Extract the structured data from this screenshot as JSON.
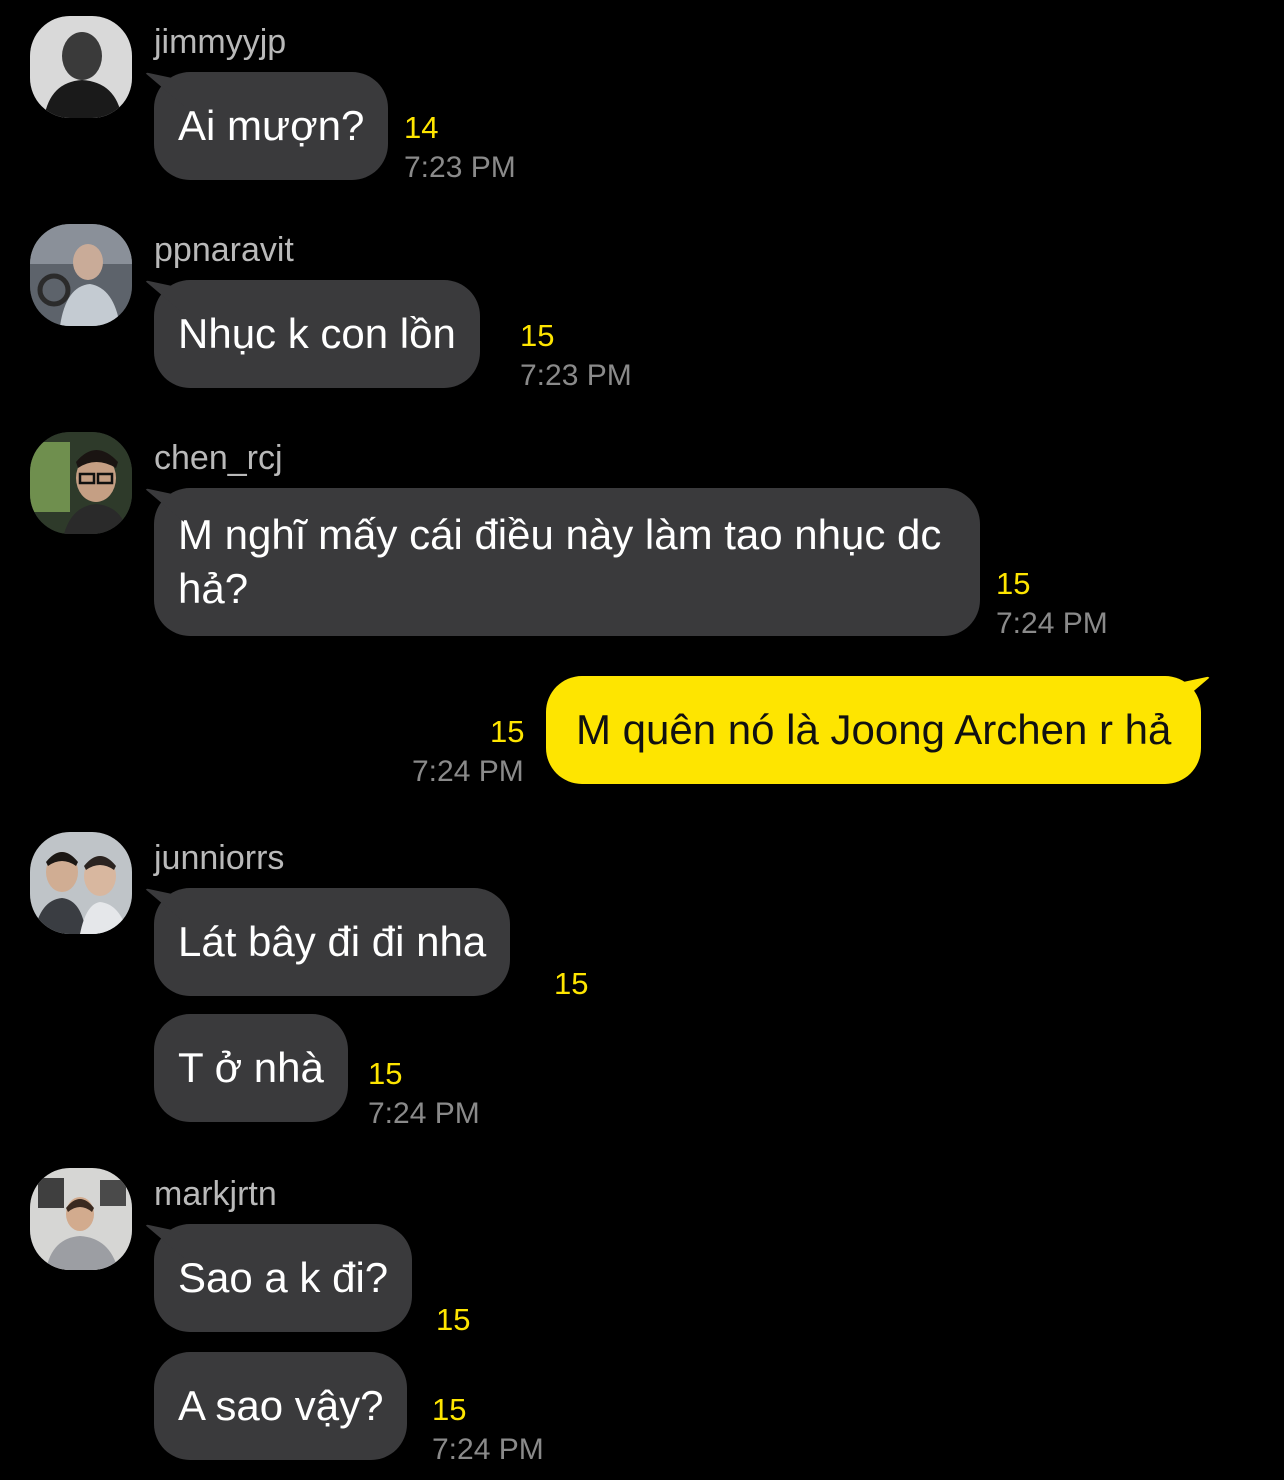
{
  "colors": {
    "background": "#000000",
    "incoming_bubble": "#3a3a3c",
    "outgoing_bubble": "#fee500",
    "unread_count": "#fee500",
    "timestamp": "#8a8a8a",
    "sender_name": "#b9b9b9"
  },
  "messages": [
    {
      "sender": "jimmyyjp",
      "avatar": "avatar-photo-icon",
      "text": "Ai mượn?",
      "unread": "14",
      "time": "7:23 PM"
    },
    {
      "sender": "ppnaravit",
      "avatar": "avatar-photo-icon",
      "text": "Nhục k con lồn",
      "unread": "15",
      "time": "7:23 PM"
    },
    {
      "sender": "chen_rcj",
      "avatar": "avatar-photo-icon",
      "text": "M nghĩ mấy cái điều này làm tao nhục dc hả?",
      "unread": "15",
      "time": "7:24 PM"
    },
    {
      "sender": "",
      "outgoing": true,
      "text": "M quên nó là Joong Archen r hả",
      "unread": "15",
      "time": "7:24 PM"
    },
    {
      "sender": "junniorrs",
      "avatar": "avatar-photo-icon",
      "text": "Lát bây đi đi nha",
      "unread": "15",
      "time": ""
    },
    {
      "sender": "",
      "text": "T ở nhà",
      "unread": "15",
      "time": "7:24 PM"
    },
    {
      "sender": "markjrtn",
      "avatar": "avatar-photo-icon",
      "text": "Sao a k đi?",
      "unread": "15",
      "time": ""
    },
    {
      "sender": "",
      "text": "A sao vậy?",
      "unread": "15",
      "time": "7:24 PM"
    }
  ]
}
